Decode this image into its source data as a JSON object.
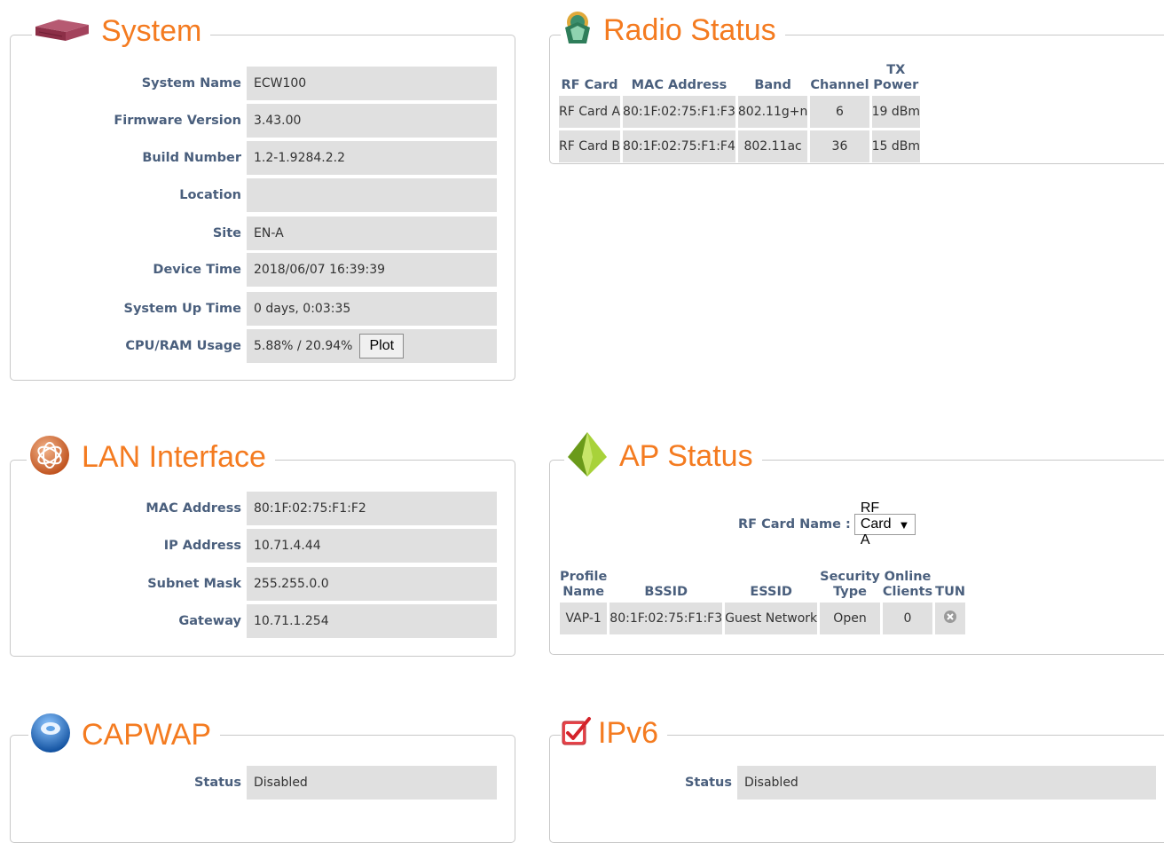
{
  "system": {
    "title": "System",
    "rows": [
      {
        "label": "System Name",
        "value": "ECW100"
      },
      {
        "label": "Firmware Version",
        "value": "3.43.00"
      },
      {
        "label": "Build Number",
        "value": "1.2-1.9284.2.2"
      },
      {
        "label": "Location",
        "value": ""
      },
      {
        "label": "Site",
        "value": "EN-A"
      },
      {
        "label": "Device Time",
        "value": "2018/06/07 16:39:39"
      },
      {
        "label": "System Up Time",
        "value": "0 days, 0:03:35"
      },
      {
        "label": "CPU/RAM Usage",
        "value": "5.88% / 20.94%"
      }
    ],
    "plot_button": "Plot"
  },
  "radio": {
    "title": "Radio Status",
    "headers": [
      "RF Card",
      "MAC Address",
      "Band",
      "Channel",
      "TX Power"
    ],
    "rows": [
      [
        "RF Card A",
        "80:1F:02:75:F1:F3",
        "802.11g+n",
        "6",
        "19 dBm"
      ],
      [
        "RF Card B",
        "80:1F:02:75:F1:F4",
        "802.11ac",
        "36",
        "15 dBm"
      ]
    ]
  },
  "lan": {
    "title": "LAN Interface",
    "rows": [
      {
        "label": "MAC Address",
        "value": "80:1F:02:75:F1:F2"
      },
      {
        "label": "IP Address",
        "value": "10.71.4.44"
      },
      {
        "label": "Subnet Mask",
        "value": "255.255.0.0"
      },
      {
        "label": "Gateway",
        "value": "10.71.1.254"
      }
    ]
  },
  "ap": {
    "title": "AP Status",
    "rf_card_label": "RF Card Name :",
    "rf_card_selected": "RF Card A",
    "select_arrow": "▼",
    "headers": [
      {
        "l1": "Profile",
        "l2": "Name"
      },
      {
        "l1": "",
        "l2": "BSSID"
      },
      {
        "l1": "",
        "l2": "ESSID"
      },
      {
        "l1": "Security",
        "l2": "Type"
      },
      {
        "l1": "Online",
        "l2": "Clients"
      },
      {
        "l1": "",
        "l2": "TUN"
      }
    ],
    "rows": [
      [
        "VAP-1",
        "80:1F:02:75:F1:F3",
        "Guest Network",
        "Open",
        "0",
        ""
      ]
    ],
    "tun_icon": "disabled-x-icon"
  },
  "capwap": {
    "title": "CAPWAP",
    "status_label": "Status",
    "status_value": "Disabled"
  },
  "ipv6": {
    "title": "IPv6",
    "status_label": "Status",
    "status_value": "Disabled"
  },
  "colors": {
    "title_orange": "#f47b20",
    "label_blue": "#4a5f7d",
    "value_bg": "#e0e0e0"
  }
}
